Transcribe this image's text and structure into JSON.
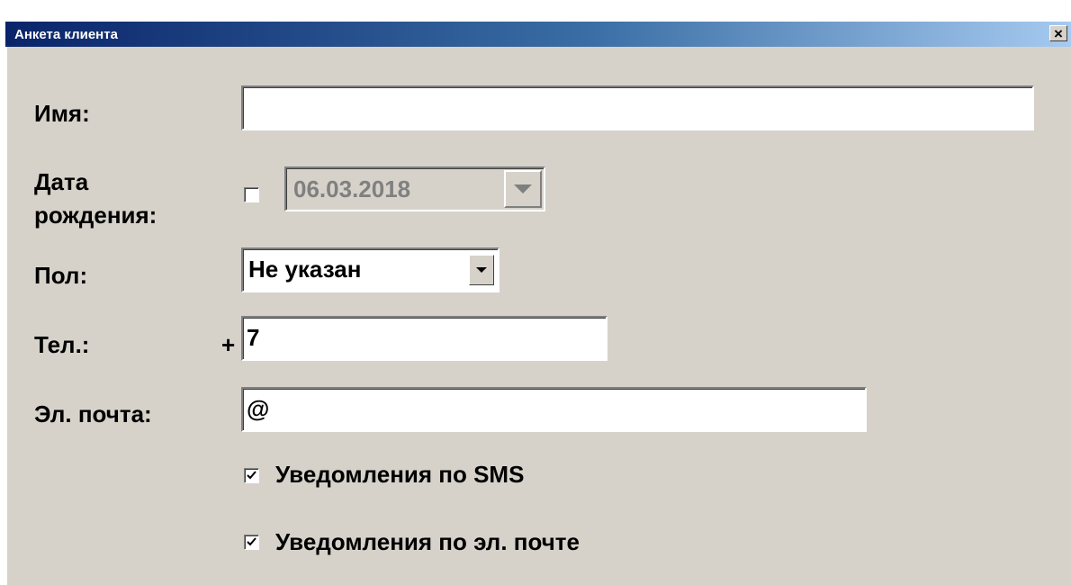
{
  "window": {
    "title": "Анкета клиента",
    "close_glyph": "×"
  },
  "form": {
    "name_label": "Имя:",
    "name_value": "",
    "birth_label_line1": "Дата",
    "birth_label_line2": "рождения:",
    "birth_enabled": false,
    "birth_date": "06.03.2018",
    "gender_label": "Пол:",
    "gender_value": "Не указан",
    "phone_label": "Тел.:",
    "phone_prefix": "+",
    "phone_value": "7",
    "email_label": "Эл. почта:",
    "email_value": "@",
    "sms_label": "Уведомления по SMS",
    "sms_checked": true,
    "email_notify_label": "Уведомления по эл. почте",
    "email_notify_checked": true
  },
  "colors": {
    "window_bg": "#d6d2ca",
    "titlebar_start": "#0a246a",
    "titlebar_end": "#a6caf0",
    "disabled_text": "#808080"
  },
  "icons": {
    "close": "close-icon",
    "dropdown": "chevron-down-icon",
    "check": "checkmark-icon"
  }
}
